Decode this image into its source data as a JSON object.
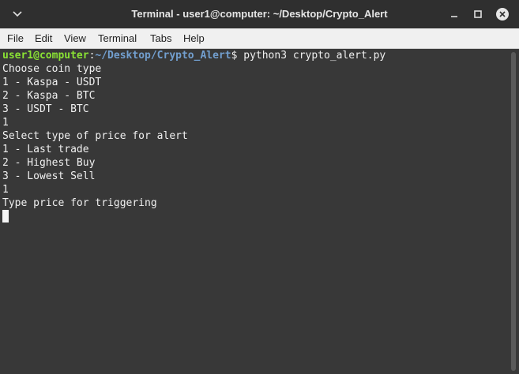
{
  "window": {
    "title": "Terminal - user1@computer: ~/Desktop/Crypto_Alert"
  },
  "menubar": {
    "items": [
      "File",
      "Edit",
      "View",
      "Terminal",
      "Tabs",
      "Help"
    ]
  },
  "terminal": {
    "prompt": {
      "user_host": "user1@computer",
      "separator": ":",
      "path": "~/Desktop/Crypto_Alert",
      "symbol": "$",
      "command": " python3 crypto_alert.py"
    },
    "output": [
      "Choose coin type",
      "1 - Kaspa - USDT",
      "2 - Kaspa - BTC",
      "3 - USDT - BTC",
      "1",
      "Select type of price for alert",
      "1 - Last trade",
      "2 - Highest Buy",
      "3 - Lowest Sell",
      "1",
      "Type price for triggering"
    ]
  },
  "icons": {
    "window_menu": "chevron-down-icon",
    "minimize": "minimize-icon",
    "maximize": "maximize-icon",
    "close": "close-icon"
  },
  "colors": {
    "prompt_user": "#8ae234",
    "prompt_path": "#729fcf",
    "terminal_bg": "#383838",
    "terminal_fg": "#f0f0f0",
    "titlebar_bg": "#2f2f2f",
    "menubar_bg": "#f0f0f0"
  }
}
